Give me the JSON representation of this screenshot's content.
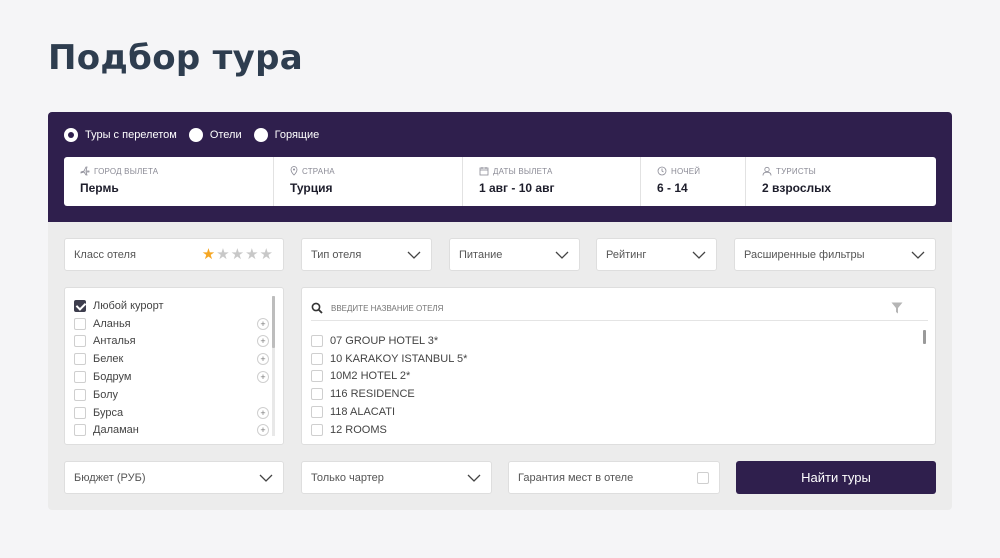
{
  "page": {
    "title": "Подбор тура"
  },
  "tour_types": [
    {
      "label": "Туры с перелетом",
      "checked": true
    },
    {
      "label": "Отели",
      "checked": false
    },
    {
      "label": "Горящие",
      "checked": false
    }
  ],
  "search": {
    "departure": {
      "label": "город вылета",
      "icon": "plane-icon",
      "value": "Пермь"
    },
    "country": {
      "label": "страна",
      "icon": "location-pin-icon",
      "value": "Турция"
    },
    "dates": {
      "label": "даты вылета",
      "icon": "calendar-icon",
      "value": "1 авг - 10 авг"
    },
    "nights": {
      "label": "ночей",
      "icon": "clock-icon",
      "value": "6 - 14"
    },
    "tourists": {
      "label": "туристы",
      "icon": "user-icon",
      "value": "2 взрослых"
    }
  },
  "filters": {
    "hotel_class": {
      "label": "Класс отеля",
      "stars_selected": 1,
      "stars_total": 5
    },
    "hotel_type": {
      "label": "Тип отеля"
    },
    "meals": {
      "label": "Питание"
    },
    "rating": {
      "label": "Рейтинг"
    },
    "advanced": {
      "label": "Расширенные фильтры"
    }
  },
  "resorts": [
    {
      "name": "Любой курорт",
      "checked": true,
      "expandable": false
    },
    {
      "name": "Аланья",
      "checked": false,
      "expandable": true
    },
    {
      "name": "Анталья",
      "checked": false,
      "expandable": true
    },
    {
      "name": "Белек",
      "checked": false,
      "expandable": true
    },
    {
      "name": "Бодрум",
      "checked": false,
      "expandable": true
    },
    {
      "name": "Болу",
      "checked": false,
      "expandable": false
    },
    {
      "name": "Бурса",
      "checked": false,
      "expandable": true
    },
    {
      "name": "Даламан",
      "checked": false,
      "expandable": true
    }
  ],
  "hotel_search": {
    "placeholder": "Введите название отеля"
  },
  "hotels": [
    "07 GROUP HOTEL 3*",
    "10 KARAKOY ISTANBUL 5*",
    "10M2 HOTEL 2*",
    "116 RESIDENCE",
    "118 ALACATI",
    "12 ROOMS"
  ],
  "bottom": {
    "budget": {
      "label": "Бюджет (РУБ)"
    },
    "charter": {
      "label": "Только чартер"
    },
    "guarantee": {
      "label": "Гарантия мест в отеле",
      "checked": false
    },
    "find_button": "Найти туры"
  },
  "colors": {
    "brand": "#2f1f4d",
    "star": "#f5a623",
    "panel_bg": "#ececec"
  }
}
